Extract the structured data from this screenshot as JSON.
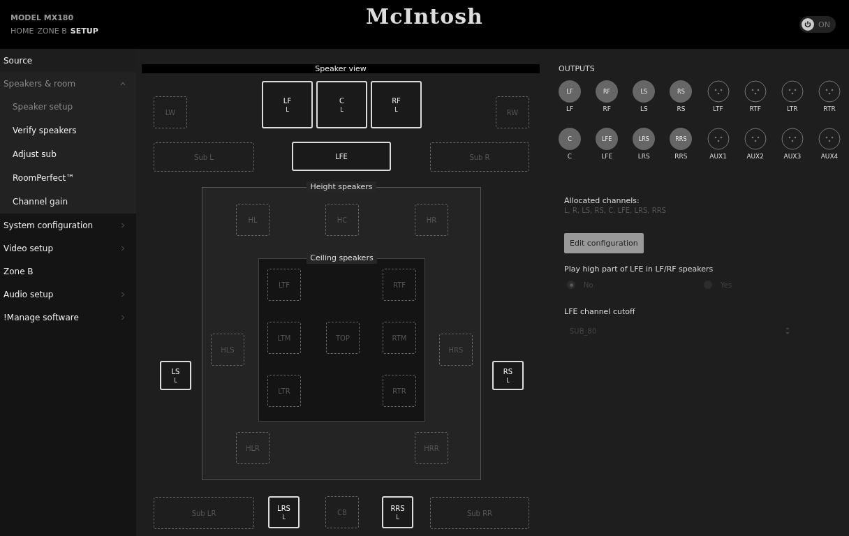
{
  "header": {
    "model": "MODEL MX180",
    "nav": [
      {
        "label": "HOME",
        "selected": false
      },
      {
        "label": "ZONE B",
        "selected": false
      },
      {
        "label": "SETUP",
        "selected": true
      }
    ],
    "logo": "McIntosh",
    "power": {
      "label": "ON",
      "on": true
    }
  },
  "sidebar": {
    "items": [
      {
        "label": "Source",
        "kind": "link",
        "selected": false
      },
      {
        "label": "Speakers & room",
        "kind": "group",
        "expanded": true,
        "selected": false,
        "children": [
          {
            "label": "Speaker setup",
            "selected": true
          },
          {
            "label": "Verify speakers",
            "selected": false
          },
          {
            "label": "Adjust sub",
            "selected": false
          },
          {
            "label": "RoomPerfect™",
            "selected": false
          },
          {
            "label": "Channel gain",
            "selected": false
          }
        ]
      },
      {
        "label": "System configuration",
        "kind": "group",
        "expanded": false,
        "selected": false
      },
      {
        "label": "Video setup",
        "kind": "group",
        "expanded": false,
        "selected": false
      },
      {
        "label": "Zone B",
        "kind": "link",
        "selected": false
      },
      {
        "label": "Audio setup",
        "kind": "group",
        "expanded": false,
        "selected": false
      },
      {
        "label": "!Manage software",
        "kind": "group",
        "expanded": false,
        "selected": false
      }
    ]
  },
  "speaker_view": {
    "title": "Speaker view",
    "speakers": [
      {
        "label": "LW",
        "active": false
      },
      {
        "label": "LF",
        "sub": "L",
        "active": true
      },
      {
        "label": "C",
        "sub": "L",
        "active": true
      },
      {
        "label": "RF",
        "sub": "L",
        "active": true
      },
      {
        "label": "RW",
        "active": false
      },
      {
        "label": "Sub L",
        "active": false
      },
      {
        "label": "LFE",
        "active": true
      },
      {
        "label": "Sub R",
        "active": false
      },
      {
        "label": "LS",
        "sub": "L",
        "active": true
      },
      {
        "label": "RS",
        "sub": "L",
        "active": true
      },
      {
        "label": "Sub LR",
        "active": false
      },
      {
        "label": "LRS",
        "sub": "L",
        "active": true
      },
      {
        "label": "CB",
        "active": false
      },
      {
        "label": "RRS",
        "sub": "L",
        "active": true
      },
      {
        "label": "Sub RR",
        "active": false
      }
    ],
    "height_speakers": {
      "title": "Height speakers",
      "speakers": [
        {
          "label": "HL",
          "active": false
        },
        {
          "label": "HC",
          "active": false
        },
        {
          "label": "HR",
          "active": false
        },
        {
          "label": "HLS",
          "active": false
        },
        {
          "label": "HRS",
          "active": false
        },
        {
          "label": "HLR",
          "active": false
        },
        {
          "label": "HRR",
          "active": false
        }
      ]
    },
    "ceiling_speakers": {
      "title": "Ceiling speakers",
      "speakers": [
        {
          "label": "LTF",
          "active": false
        },
        {
          "label": "RTF",
          "active": false
        },
        {
          "label": "LTM",
          "active": false
        },
        {
          "label": "TOP",
          "active": false
        },
        {
          "label": "RTM",
          "active": false
        },
        {
          "label": "LTR",
          "active": false
        },
        {
          "label": "RTR",
          "active": false
        }
      ]
    }
  },
  "outputs": {
    "title": "OUTPUTS",
    "rows": [
      [
        {
          "badge": "LF",
          "label": "LF",
          "assigned": true
        },
        {
          "badge": "RF",
          "label": "RF",
          "assigned": true
        },
        {
          "badge": "LS",
          "label": "LS",
          "assigned": true
        },
        {
          "badge": "RS",
          "label": "RS",
          "assigned": true
        },
        {
          "label": "LTF",
          "assigned": false
        },
        {
          "label": "RTF",
          "assigned": false
        },
        {
          "label": "LTR",
          "assigned": false
        },
        {
          "label": "RTR",
          "assigned": false
        }
      ],
      [
        {
          "badge": "C",
          "label": "C",
          "assigned": true
        },
        {
          "badge": "LFE",
          "label": "LFE",
          "assigned": true
        },
        {
          "badge": "LRS",
          "label": "LRS",
          "assigned": true
        },
        {
          "badge": "RRS",
          "label": "RRS",
          "assigned": true
        },
        {
          "label": "AUX1",
          "assigned": false
        },
        {
          "label": "AUX2",
          "assigned": false
        },
        {
          "label": "AUX3",
          "assigned": false
        },
        {
          "label": "AUX4",
          "assigned": false
        }
      ]
    ]
  },
  "allocated": {
    "label": "Allocated channels:",
    "value": "L, R, LS, RS, C, LFE, LRS, RRS"
  },
  "edit_button": "Edit configuration",
  "lfe_high": {
    "label": "Play high part of LFE in LF/RF speakers",
    "options": [
      {
        "label": "No",
        "selected": true
      },
      {
        "label": "Yes",
        "selected": false
      }
    ]
  },
  "lfe_cutoff": {
    "label": "LFE channel cutoff",
    "value": "SUB_80"
  }
}
